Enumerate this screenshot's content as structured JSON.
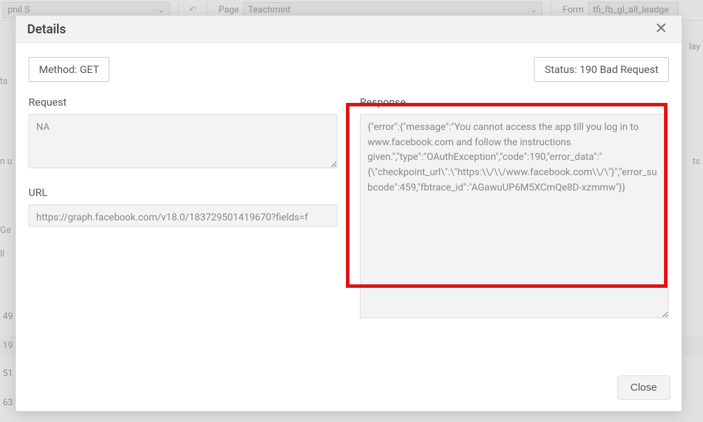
{
  "background": {
    "user_dropdown": "pnil S",
    "page_label": "Page",
    "page_value": "Teachmint",
    "form_label": "Form",
    "form_value": "tfi_fb_gl_all_leadge",
    "side_fragments": {
      "f1": "ts",
      "f2": "n u",
      "f3": "Ge",
      "f4": "ll",
      "f5": "lay",
      "f6": "ts"
    },
    "row_nums": {
      "r1": "49",
      "r2": "19",
      "r3": "51",
      "r4": "63"
    }
  },
  "modal": {
    "title": "Details",
    "method_badge": "Method: GET",
    "status_badge": "Status: 190 Bad Request",
    "request_label": "Request",
    "request_value": "NA",
    "url_label": "URL",
    "url_value": "https://graph.facebook.com/v18.0/183729501419670?fields=f",
    "response_label": "Response",
    "response_value": "{\"error\":{\"message\":\"You cannot access the app till you log in to www.facebook.com and follow the instructions given.\",\"type\":\"OAuthException\",\"code\":190,\"error_data\":\"{\\\"checkpoint_url\\\":\\\"https:\\\\/\\\\/www.facebook.com\\\\/\\\"}\",\"error_subcode\":459,\"fbtrace_id\":\"AGawuUP6M5XCmQe8D-xzmmw\"}}",
    "close_button": "Close"
  }
}
